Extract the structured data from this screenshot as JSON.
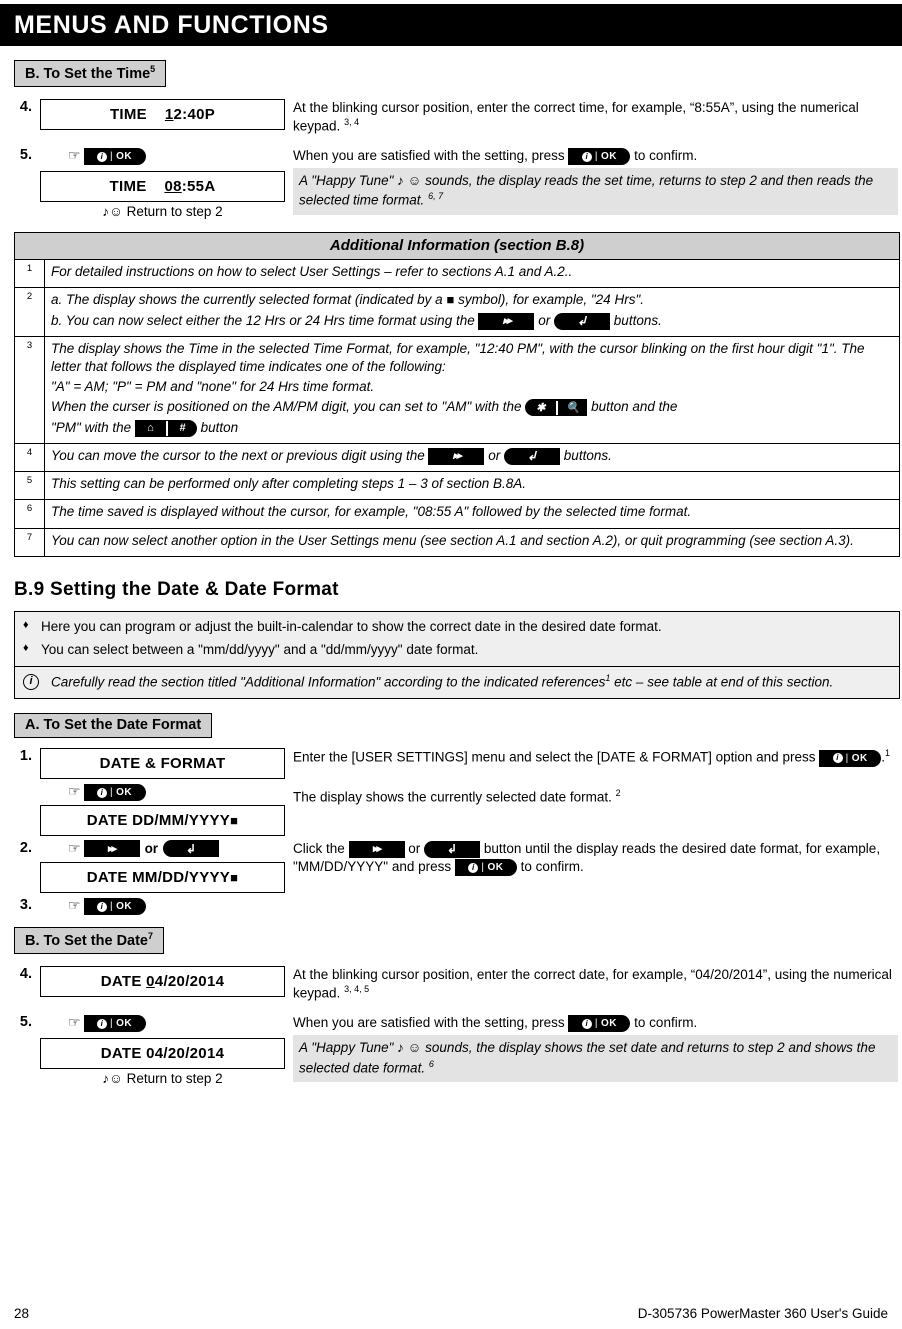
{
  "page": {
    "title": "MENUS AND FUNCTIONS",
    "footer_page_number": "28",
    "footer_doc": "D-305736 PowerMaster 360 User's Guide"
  },
  "icons": {
    "ok_button": "ok-button",
    "forward_button": "forward-button",
    "back_button": "back-button",
    "am_button": "star-search-button",
    "pm_button": "home-hash-button",
    "hand_pointer": "☞",
    "music_note": "♪",
    "smiley": "☺",
    "diamond_bullet": "♦",
    "black_square": "■",
    "info": "i"
  },
  "section_b8": {
    "heading": "B. To Set the Time",
    "heading_sup": "5",
    "steps": [
      {
        "number": "4.",
        "lcd_label": "TIME",
        "lcd_cursor": "1",
        "lcd_rest": "2:40P",
        "text_html": "At the blinking cursor position, enter the correct time, for example, “8:55A”, using the numerical keypad.",
        "text_sup": "3, 4"
      },
      {
        "number": "5.",
        "press_text_pre": "When you are satisfied with the setting, press",
        "press_text_post": "to confirm.",
        "lcd_label": "TIME",
        "lcd_cursor": "08",
        "lcd_rest": ":55A",
        "return_text": "Return to step 2",
        "shaded_text": "A \"Happy Tune\" ♪ ☺ sounds, the display reads the set time, returns to step 2 and then reads the selected time format.",
        "shaded_sup": "6, 7"
      }
    ]
  },
  "additional_info": {
    "title": "Additional Information (section B.8)",
    "rows": [
      {
        "num": "1",
        "lines": [
          "For detailed instructions on how to select User Settings – refer to sections A.1 and A.2.."
        ]
      },
      {
        "num": "2",
        "line_a_pre": "a. The display shows the currently selected format (indicated by a",
        "line_a_post": "symbol), for example, \"24 Hrs\".",
        "line_b_pre": "b. You can now select either the 12 Hrs or 24 Hrs time format using the",
        "line_b_mid": "or",
        "line_b_post": "buttons."
      },
      {
        "num": "3",
        "line_1": "The display shows the Time in the selected Time Format, for example, \"12:40 PM\", with the cursor blinking on the first hour digit \"1\". The letter that follows the displayed time indicates one of the following:",
        "line_2": "\"A\" = AM; \"P\" = PM and \"none\" for 24 Hrs time format.",
        "line_3_pre": "When the curser is positioned on the AM/PM digit, you can set to \"AM\" with the",
        "line_3_mid": "button and the",
        "line_3_post2": "\"PM\" with the",
        "line_3_end": "button"
      },
      {
        "num": "4",
        "pre": "You can move the cursor to the next or previous digit using the",
        "mid": "or",
        "post": "buttons."
      },
      {
        "num": "5",
        "lines": [
          "This setting can be performed only after completing steps 1 – 3 of section B.8A."
        ]
      },
      {
        "num": "6",
        "lines": [
          "The time saved is displayed without the cursor, for example, \"08:55 A\" followed by the selected time format."
        ]
      },
      {
        "num": "7",
        "lines": [
          "You can now select another option in the User Settings menu (see section A.1 and section A.2), or quit programming (see section A.3)."
        ]
      }
    ]
  },
  "section_b9": {
    "heading": "B.9 Setting the Date & Date Format",
    "bullets": [
      "Here you can program or adjust the built-in-calendar to show the correct date in the desired date format.",
      "You can select between a \"mm/dd/yyyy\" and a \"dd/mm/yyyy\" date format."
    ],
    "note": {
      "text_pre": "Carefully read the section titled \"Additional Information\" according to the indicated references",
      "text_sup": "1",
      "text_post": " etc – see table at end of this section."
    },
    "part_a": {
      "heading": "A. To Set the Date Format",
      "step1": {
        "number": "1.",
        "lcd1": "DATE & FORMAT",
        "text_pre": "Enter the [USER SETTINGS] menu and select the [DATE & FORMAT] option and press",
        "text_post": ".",
        "text_sup": "1",
        "lcd2": "DATE DD/MM/YYYY",
        "lcd2_desc": "The display shows the currently selected date format.",
        "lcd2_sup": "2"
      },
      "step2": {
        "number": "2.",
        "or_label": "or",
        "text_pre": "Click the",
        "text_mid": "or",
        "text_post": "button until the display reads the desired date format, for example, \"MM/DD/YYYY\" and press",
        "text_end": "to confirm.",
        "lcd": "DATE MM/DD/YYYY"
      },
      "step3": {
        "number": "3."
      }
    },
    "part_b": {
      "heading": "B. To Set the Date",
      "heading_sup": "7",
      "step4": {
        "number": "4.",
        "lcd_label": "DATE",
        "lcd_cursor": "0",
        "lcd_rest": "4/20/2014",
        "text": "At the blinking cursor position, enter the correct date, for example, “04/20/2014”, using the numerical keypad.",
        "text_sup": "3, 4, 5"
      },
      "step5": {
        "number": "5.",
        "press_pre": "When you are satisfied with the setting, press",
        "press_post": "to confirm.",
        "lcd": "DATE 04/20/2014",
        "return_text": "Return to step 2",
        "shaded_text": "A \"Happy Tune\" ♪ ☺ sounds, the display shows the set date and returns to step 2 and shows the selected date format.",
        "shaded_sup": "6"
      }
    }
  }
}
